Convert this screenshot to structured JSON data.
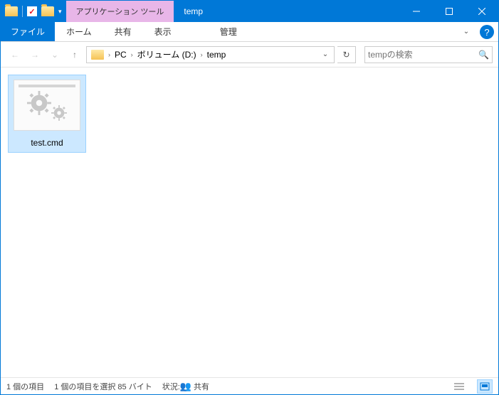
{
  "titlebar": {
    "tool_tab_label": "アプリケーション ツール",
    "window_title": "temp"
  },
  "ribbon": {
    "file": "ファイル",
    "home": "ホーム",
    "share": "共有",
    "view": "表示",
    "manage": "管理"
  },
  "nav": {
    "breadcrumb": {
      "items": [
        "PC",
        "ボリューム (D:)",
        "temp"
      ]
    },
    "search_placeholder": "tempの検索"
  },
  "files": [
    {
      "name": "test.cmd"
    }
  ],
  "status": {
    "count": "1 個の項目",
    "selection": "1 個の項目を選択 85 バイト",
    "state_label": "状況:",
    "share_label": "共有"
  }
}
